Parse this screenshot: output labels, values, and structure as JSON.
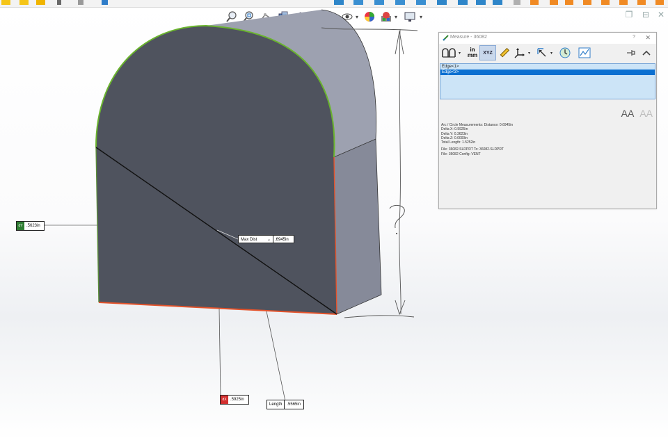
{
  "app": {
    "name": "SOLIDWORKS measure view"
  },
  "callouts": {
    "left": {
      "tag": "dY",
      "value": ".5623in"
    },
    "bottom": {
      "tag": "dX",
      "value": ".5925in"
    },
    "length": {
      "label": "Length",
      "value": ".5565in"
    },
    "center": {
      "selected_option": "Max Dist",
      "value": ".6945in"
    }
  },
  "measure_dialog": {
    "title": "Measure - 36082",
    "help": "?",
    "close": "✕",
    "units": {
      "top": "in",
      "bottom": "mm"
    },
    "xyz": "XYZ",
    "selections": [
      "Edge<1>",
      "Edge<3>"
    ],
    "selected_index": 1,
    "results": [
      "Arc / Circle Measurements: Distance: 0.6945in",
      "Delta X: 0.5925in",
      "Delta Y: 0.3623in",
      "Delta Z: 0.0000in",
      "Total Length: 1.5252in",
      "",
      "File: 36082.SLDPRT To: 36082.SLDPRT",
      "File: 36082 Config: VENT"
    ]
  },
  "annotation": {
    "question_mark": "?"
  },
  "colors": {
    "face_front": "#4f535e",
    "face_side": "#868a99",
    "face_top": "#9da1b0",
    "edge_green": "#6ab42e",
    "edge_red": "#e4532b",
    "tag_green": "#2e7d32",
    "tag_red": "#d32f2f",
    "selection_blue": "#0a6fd1"
  }
}
